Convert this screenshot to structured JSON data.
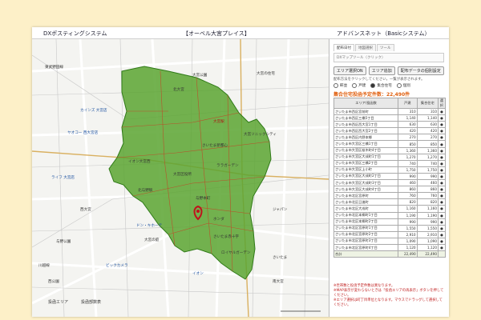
{
  "header": {
    "app_name": "DXポスティングシステム",
    "project": "【オーベル大宮プレイス】",
    "company": "アドバンスネット（Basicシステム）"
  },
  "map": {
    "labels": [
      "東武野田線",
      "大宮公園",
      "大宮の住宅",
      "カインズ 大宮店",
      "ヤオコー 西大宮店",
      "大宮駅",
      "さいたま新都心",
      "イオン大宮西",
      "ララガーデン",
      "大宮区役所",
      "ライフ 大宮店",
      "北与野駅",
      "与野本町",
      "西大宮",
      "ドン・キホーテ",
      "ホンダ",
      "大宮の庭",
      "さいたま赤十字",
      "与野公園",
      "西公園",
      "ロイヤルガーデン",
      "ビックカメラ",
      "川越線",
      "さいたま",
      "ジャパン",
      "イオン",
      "大宮ソニックシティ",
      "北大宮",
      "南大宮"
    ],
    "pin_color": "#c0121c",
    "area_color": "#5aa531"
  },
  "panel": {
    "tabs": [
      "配布日付",
      "地図選択",
      "ツール"
    ],
    "subtab": "DXマップツール（クリック）",
    "buttons": [
      "エリア選択ON",
      "エリア追加",
      "配布データの個別設定"
    ],
    "instruction": "配布方法をクリックしてください。一覧が表示されます。",
    "radio_options": [
      "軒並",
      "戸建",
      "集合住宅",
      "個別"
    ],
    "radio_selected": 2,
    "total_label": "集合住宅投函予定件数：22,490件",
    "columns": [
      "エリア/投函数",
      "戸建",
      "集合住宅",
      "選択"
    ],
    "rows": [
      [
        "さいたま市西区宮前町",
        "310",
        "310",
        "●"
      ],
      [
        "さいたま市西区三橋5丁目",
        "1,140",
        "1,140",
        "●"
      ],
      [
        "さいたま市西区西大宮1丁目",
        "630",
        "630",
        "●"
      ],
      [
        "さいたま市西区西大宮2丁目",
        "420",
        "420",
        "●"
      ],
      [
        "さいたま市西区内野本郷",
        "270",
        "270",
        "●"
      ],
      [
        "さいたま市大宮区三橋1丁目",
        "850",
        "850",
        "●"
      ],
      [
        "さいたま市大宮区桜木町4丁目",
        "1,360",
        "1,360",
        "●"
      ],
      [
        "さいたま市大宮区大成町1丁目",
        "1,270",
        "1,270",
        "●"
      ],
      [
        "さいたま市大宮区三橋2丁目",
        "740",
        "740",
        "●"
      ],
      [
        "さいたま市大宮区上小町",
        "1,750",
        "1,750",
        "●"
      ],
      [
        "さいたま市大宮区大成町2丁目",
        "990",
        "990",
        "●"
      ],
      [
        "さいたま市大宮区大成町3丁目",
        "460",
        "460",
        "●"
      ],
      [
        "さいたま市大宮区大成町4丁目",
        "860",
        "860",
        "●"
      ],
      [
        "さいたま市北区宮原町",
        "760",
        "760",
        "●"
      ],
      [
        "さいたま市北区日進町",
        "820",
        "820",
        "●"
      ],
      [
        "さいたま市北区大成町",
        "1,160",
        "1,160",
        "●"
      ],
      [
        "さいたま市北区本郷町1丁目",
        "1,190",
        "1,190",
        "●"
      ],
      [
        "さいたま市北区本郷町2丁目",
        "990",
        "990",
        "●"
      ],
      [
        "さいたま市北区宮原町1丁目",
        "1,550",
        "1,550",
        "●"
      ],
      [
        "さいたま市北区宮原町2丁目",
        "2,910",
        "2,910",
        "●"
      ],
      [
        "さいたま市北区宮原町3丁目",
        "1,090",
        "1,090",
        "●"
      ],
      [
        "さいたま市北区宮原町4丁目",
        "1,120",
        "1,120",
        "●"
      ]
    ],
    "sum_row": [
      "合計",
      "22,490",
      "22,490",
      ""
    ],
    "footnotes": [
      "※世帯数と投函予定件数は異なります。",
      "※MAP表示が変わらないときは「投函エリアの再表示」ボタンを押してください。",
      "※エリア選択は町丁目単位となります。マウスでドラッグして選択してください。"
    ],
    "bottom_tabs": [
      "投函エリア",
      "投函部数表"
    ]
  }
}
